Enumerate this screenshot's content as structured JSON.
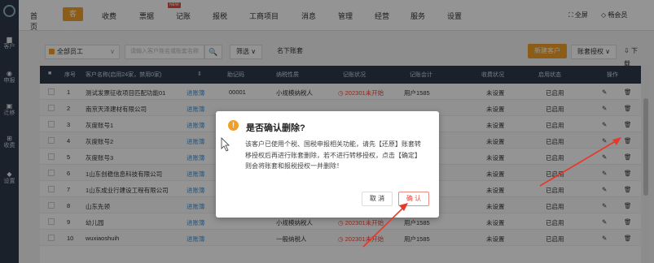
{
  "sidebar": {
    "items": [
      {
        "icon": "▆",
        "label": "客户"
      },
      {
        "icon": "◉",
        "label": "申报"
      },
      {
        "icon": "▣",
        "label": "迁移"
      },
      {
        "icon": "⊞",
        "label": "收费"
      },
      {
        "icon": "◆",
        "label": "设置"
      }
    ]
  },
  "nav": {
    "items": [
      "首页",
      "客户",
      "收费",
      "票据",
      "记账",
      "报税",
      "工商项目",
      "消息",
      "管理",
      "经营",
      "服务",
      "设置"
    ],
    "new_badge": "NEW",
    "fullscreen": "全屏",
    "vip": "畅会员"
  },
  "toolbar": {
    "staff_select": "全部员工",
    "search_placeholder": "请输入客户姓名或账套名称",
    "search_icon": "🔍",
    "filter": "筛选",
    "unnamed": "名下账套",
    "new_customer": "新建客户",
    "transfer_auth": "账套授权",
    "download": "下载"
  },
  "table": {
    "headers": {
      "index": "序号",
      "name": "客户名称(启用24家，禁用0家)",
      "code": "助记码",
      "tax_type": "纳税性质",
      "account_status": "记账状况",
      "accountant": "记账会计",
      "fee_status": "收费状况",
      "enable_status": "启用状态",
      "ops": "操作"
    },
    "rows": [
      {
        "idx": "1",
        "name": "测试发票征收项目匹配功能01",
        "tag": "进账簿",
        "code": "00001",
        "tax": "小规模纳税人",
        "status": "202301未开始",
        "acct": "用户1585",
        "fee": "未设置",
        "enable": "已启用"
      },
      {
        "idx": "2",
        "name": "南京天泽建材有限公司",
        "tag": "进账簿",
        "code": "",
        "tax": "",
        "status": "",
        "acct": "",
        "fee": "未设置",
        "enable": "已启用"
      },
      {
        "idx": "3",
        "name": "灰度账号1",
        "tag": "进账簿",
        "code": "",
        "tax": "",
        "status": "",
        "acct": "",
        "fee": "未设置",
        "enable": "已启用"
      },
      {
        "idx": "4",
        "name": "灰度账号2",
        "tag": "进账簿",
        "code": "",
        "tax": "",
        "status": "",
        "acct": "",
        "fee": "未设置",
        "enable": "已启用"
      },
      {
        "idx": "5",
        "name": "灰度账号3",
        "tag": "进账簿",
        "code": "",
        "tax": "",
        "status": "",
        "acct": "",
        "fee": "未设置",
        "enable": "已启用"
      },
      {
        "idx": "6",
        "name": "1山东创稳信息科技有限公司",
        "tag": "进账簿",
        "code": "",
        "tax": "",
        "status": "",
        "acct": "",
        "fee": "未设置",
        "enable": "已启用"
      },
      {
        "idx": "7",
        "name": "1山东成业行建设工程有限公司",
        "tag": "进账簿",
        "code": "",
        "tax": "",
        "status": "",
        "acct": "",
        "fee": "未设置",
        "enable": "已启用"
      },
      {
        "idx": "8",
        "name": "山东先领",
        "tag": "进账簿",
        "code": "",
        "tax": "",
        "status": "",
        "acct": "",
        "fee": "未设置",
        "enable": "已启用"
      },
      {
        "idx": "9",
        "name": "幼儿园",
        "tag": "进账簿",
        "code": "",
        "tax": "小规模纳税人",
        "status": "202301未开始",
        "acct": "用户1585",
        "fee": "未设置",
        "enable": "已启用"
      },
      {
        "idx": "10",
        "name": "wuxiaoshuih",
        "tag": "进账簿",
        "code": "",
        "tax": "一般纳税人",
        "status": "202301未开始",
        "acct": "用户1585",
        "fee": "未设置",
        "enable": "已启用"
      }
    ]
  },
  "dialog": {
    "title": "是否确认删除?",
    "body": "该客户已使用个税、国税申报相关功能，请先【还原】账套转移授权后再进行账套删除，若不进行转移授权，点击【确定】则会将账套和报税授权一并删除！",
    "cancel": "取 消",
    "confirm": "确 认"
  },
  "colors": {
    "accent": "#f0a02a",
    "nav_dark": "#2d3a4b",
    "danger": "#e84a3c",
    "link": "#3b8fd6"
  }
}
